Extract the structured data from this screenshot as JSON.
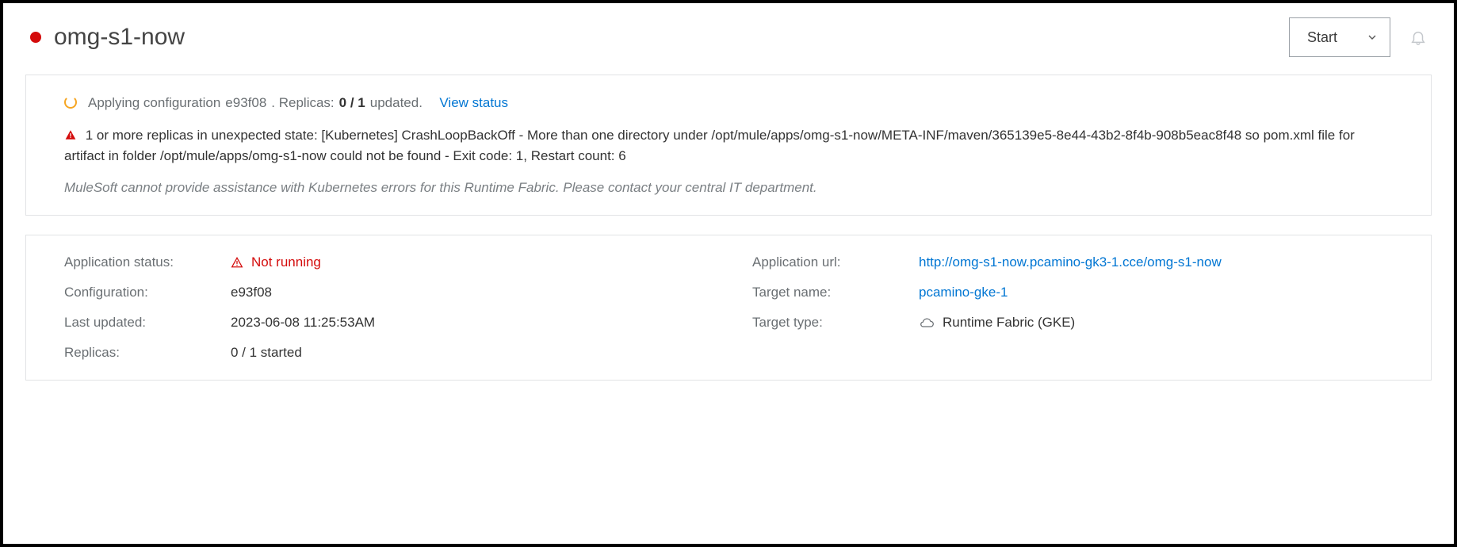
{
  "header": {
    "app_name": "omg-s1-now",
    "start_label": "Start"
  },
  "config_status": {
    "prefix": "Applying configuration ",
    "config_id": "e93f08",
    "replicas_label": ".   Replicas: ",
    "replicas_bold": "0 / 1",
    "replicas_suffix": " updated.",
    "view_status": "View status"
  },
  "error": {
    "lead": "1 or more replicas in unexpected state: ",
    "detail": "[Kubernetes] CrashLoopBackOff - More than one directory under /opt/mule/apps/omg-s1-now/META-INF/maven/365139e5-8e44-43b2-8f4b-908b5eac8f48 so pom.xml file for artifact in folder /opt/mule/apps/omg-s1-now could not be found - Exit code: 1, Restart count: 6",
    "note": "MuleSoft cannot provide assistance with Kubernetes errors for this Runtime Fabric. Please contact your central IT department."
  },
  "details_left": {
    "app_status_label": "Application status:",
    "app_status_value": "Not running",
    "configuration_label": "Configuration:",
    "configuration_value": "e93f08",
    "last_updated_label": "Last updated:",
    "last_updated_value": "2023-06-08 11:25:53AM",
    "replicas_label": "Replicas:",
    "replicas_value": "0 / 1 started"
  },
  "details_right": {
    "app_url_label": "Application url:",
    "app_url_value": "http://omg-s1-now.pcamino-gk3-1.cce/omg-s1-now",
    "target_name_label": "Target name:",
    "target_name_value": "pcamino-gke-1",
    "target_type_label": "Target type:",
    "target_type_value": "Runtime Fabric (GKE)"
  }
}
